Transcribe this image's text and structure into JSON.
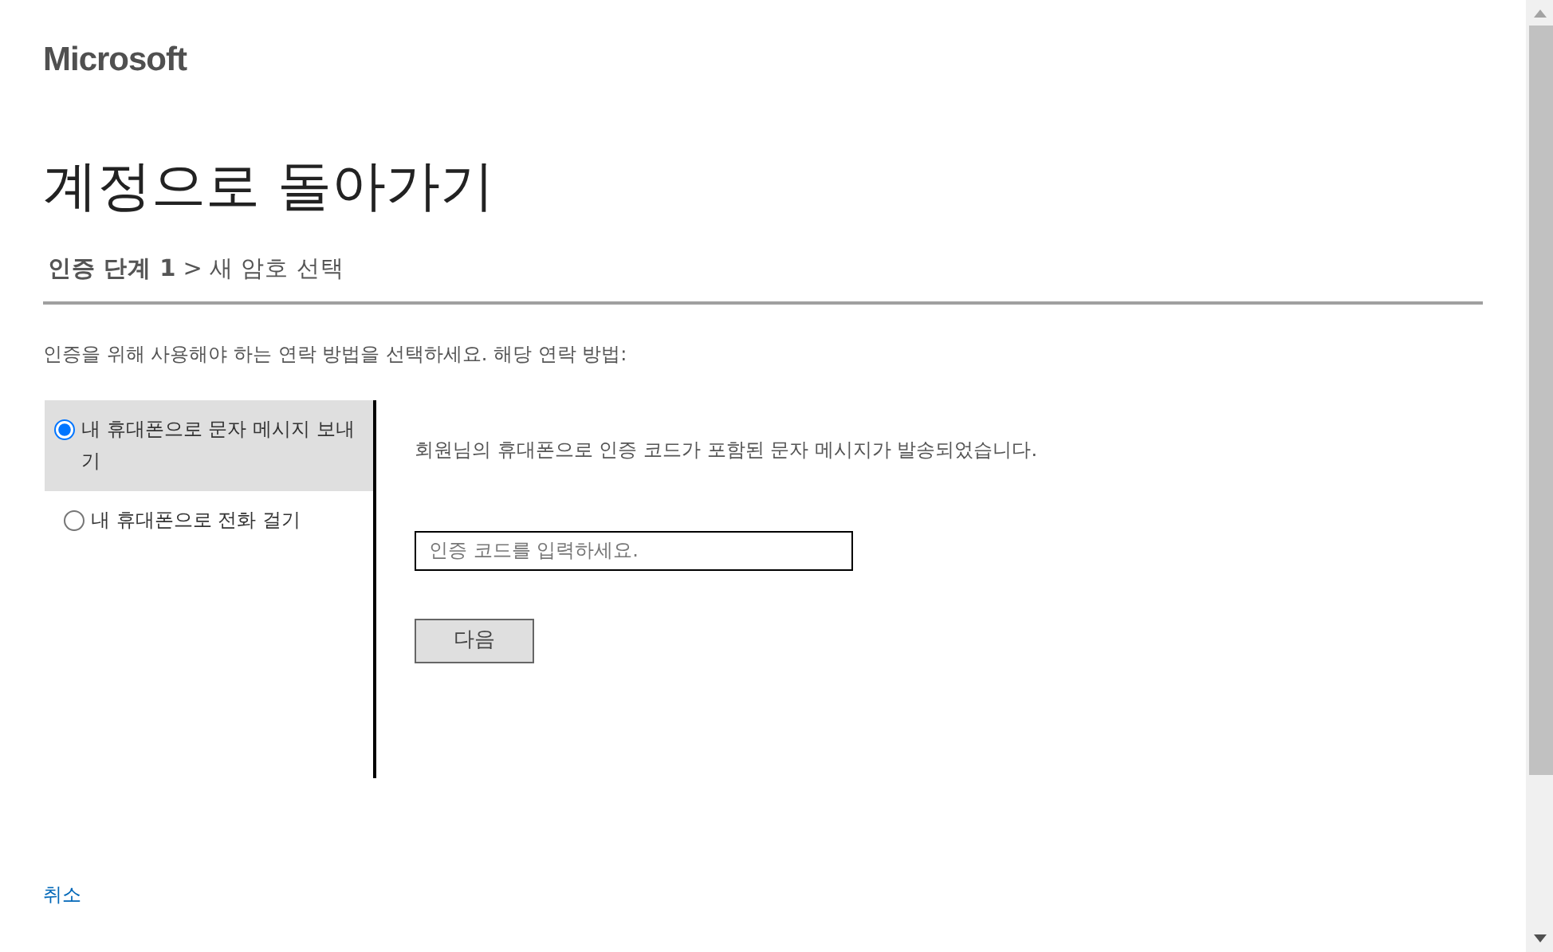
{
  "logo": "Microsoft",
  "title": "계정으로 돌아가기",
  "breadcrumb": "**인증 단계 1** > 새 암호 선택",
  "instruction": "인증을 위해 사용해야 하는 연락 방법을 선택하세요. 해당 연락 방법:",
  "methods": [
    {
      "label": "내 휴대폰으로 문자 메시지 보내기",
      "selected": true
    },
    {
      "label": "내 휴대폰으로 전화 걸기",
      "selected": false
    }
  ],
  "message": "회원님의 휴대폰으로 인증 코드가 포함된 문자 메시지가 발송되었습니다.",
  "code_field": {
    "placeholder": "인증 코드를 입력하세요."
  },
  "next_button": "다음",
  "cancel_link": "취소"
}
